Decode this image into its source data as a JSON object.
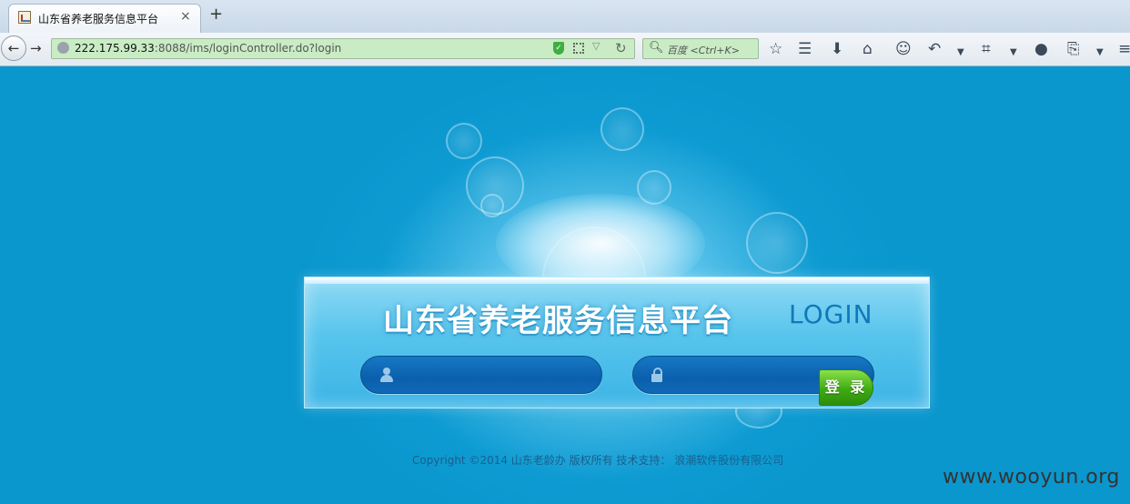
{
  "browser": {
    "tab_title": "山东省养老服务信息平台",
    "tab_close": "×",
    "new_tab": "+",
    "url_host": "222.175.99.33",
    "url_rest": ":8088/ims/loginController.do?login",
    "search_placeholder": "百度 <Ctrl+K>",
    "shield_icon": "shield-icon",
    "qr_icon": "qrcode-icon"
  },
  "login_panel": {
    "title": "山东省养老服务信息平台",
    "login_label": "LOGIN",
    "username_value": "",
    "password_value": "",
    "submit_label": "登 录"
  },
  "footer": {
    "copyright": "Copyright  ©2014 山东老龄办 版权所有   技术支持：  浪潮软件股份有限公司"
  },
  "watermark": "www.wooyun.org",
  "colors": {
    "page_background": "#0a9bd0",
    "panel_title": "#ffffff",
    "login_label": "#1178b9",
    "submit_button": "#3fab13"
  }
}
